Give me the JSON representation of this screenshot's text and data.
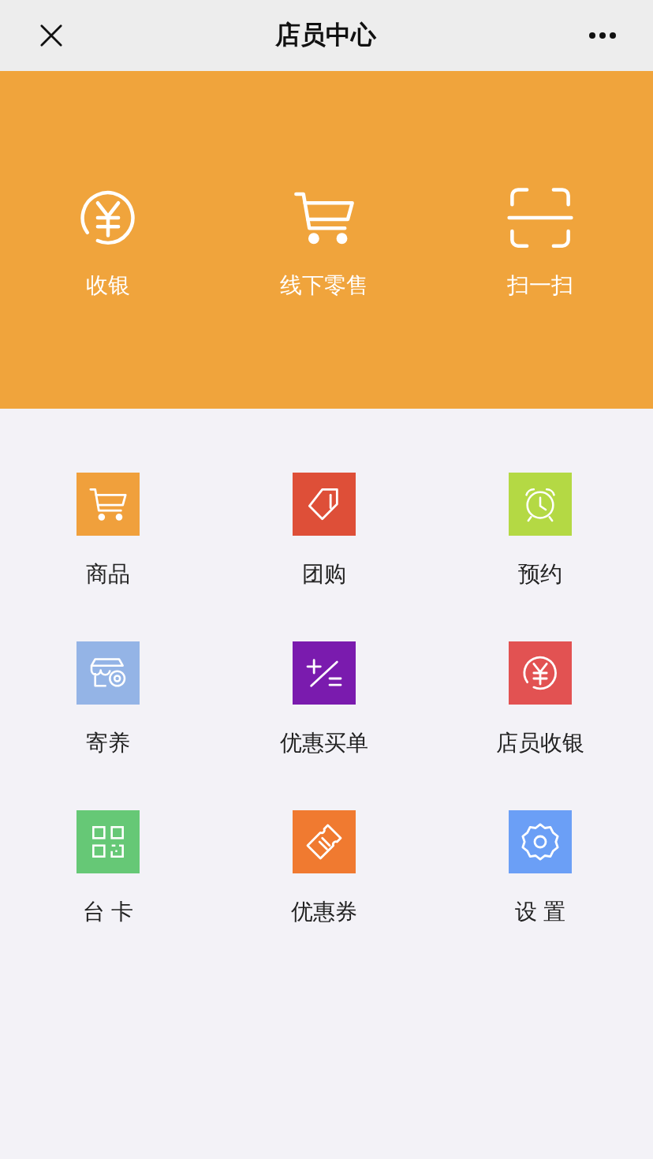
{
  "header": {
    "title": "店员中心"
  },
  "banner": [
    {
      "kind": "yen",
      "label": "收银"
    },
    {
      "kind": "cart",
      "label": "线下零售"
    },
    {
      "kind": "scan",
      "label": "扫一扫"
    }
  ],
  "grid": [
    {
      "kind": "cart",
      "label": "商品",
      "color": "#f0a03c"
    },
    {
      "kind": "tag",
      "label": "团购",
      "color": "#de4f38"
    },
    {
      "kind": "alarm",
      "label": "预约",
      "color": "#b4d944"
    },
    {
      "kind": "shop",
      "label": "寄养",
      "color": "#94b4e6"
    },
    {
      "kind": "discount",
      "label": "优惠买单",
      "color": "#7a1bae"
    },
    {
      "kind": "yen",
      "label": "店员收银",
      "color": "#e25252"
    },
    {
      "kind": "qr",
      "label": "台 卡",
      "color": "#66c876"
    },
    {
      "kind": "ticket",
      "label": "优惠券",
      "color": "#f07a30"
    },
    {
      "kind": "gear",
      "label": "设 置",
      "color": "#6b9ff6"
    }
  ]
}
